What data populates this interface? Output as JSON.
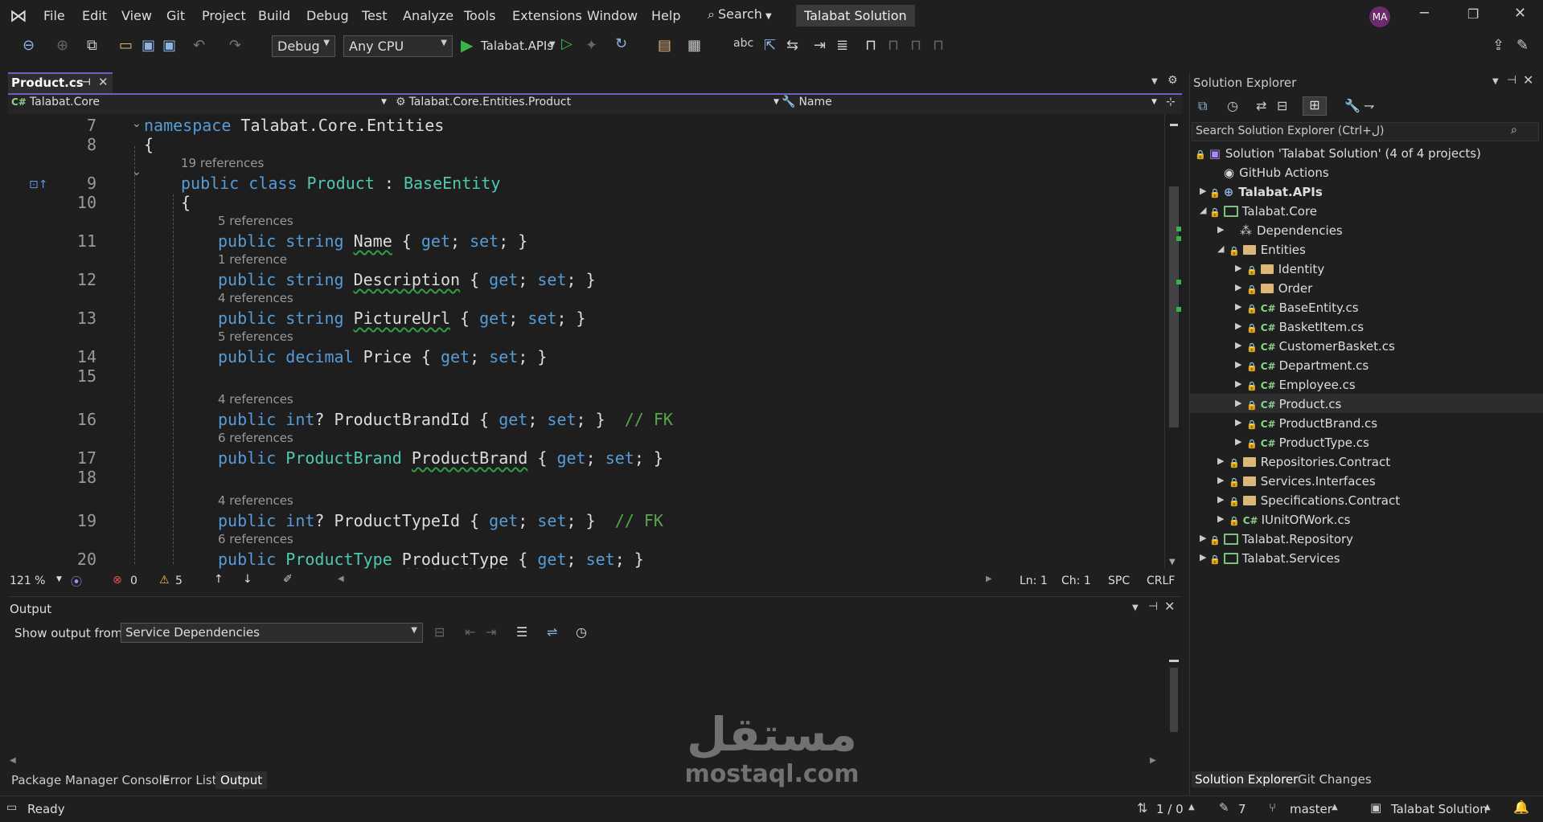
{
  "menu": {
    "items": [
      "File",
      "Edit",
      "View",
      "Git",
      "Project",
      "Build",
      "Debug",
      "Test",
      "Analyze",
      "Tools",
      "Extensions",
      "Window",
      "Help"
    ],
    "search": "Search",
    "solution_title": "Talabat Solution",
    "avatar": "MA"
  },
  "toolbar": {
    "config": "Debug",
    "platform": "Any CPU",
    "startup": "Talabat.APIs"
  },
  "tab": {
    "name": "Product.cs"
  },
  "nav": {
    "project": "Talabat.Core",
    "type": "Talabat.Core.Entities.Product",
    "member": "Name"
  },
  "code": {
    "l7": "7",
    "l8": "8",
    "l9": "9",
    "l10": "10",
    "l11": "11",
    "l12": "12",
    "l13": "13",
    "l14": "14",
    "l15": "15",
    "l16": "16",
    "l17": "17",
    "l18": "18",
    "l19": "19",
    "l20": "20",
    "r19": "19 references",
    "r5a": "5 references",
    "r1": "1 reference",
    "r4a": "4 references",
    "r5b": "5 references",
    "r4b": "4 references",
    "r6a": "6 references",
    "r4c": "4 references",
    "r6b": "6 references",
    "line7a": "namespace",
    "line7b": " Talabat.Core.Entities",
    "line8": "{",
    "line9a": "public class ",
    "line9b": "Product",
    "line9c": " : ",
    "line9d": "BaseEntity",
    "line10": "{",
    "line11a": "public string ",
    "line11b": "Name",
    "line11c": " { ",
    "get": "get",
    "semi": "; ",
    "set": "set",
    "close": "; }",
    "line12b": "Description",
    "line13b": "PictureUrl",
    "line14a": "public decimal ",
    "line14b": "Price",
    "line16a": "public int",
    "line16b": "? ProductBrandId { ",
    "fk": "// FK",
    "line17a": "public ",
    "line17b": "ProductBrand",
    "line17c": "ProductBrand",
    "line19b": "? ProductTypeId { ",
    "line20b": "ProductType",
    "line20c": "ProductType"
  },
  "editor_status": {
    "zoom": "121 %",
    "errors": "0",
    "warnings": "5",
    "ln": "Ln: 1",
    "ch": "Ch: 1",
    "spc": "SPC",
    "crlf": "CRLF"
  },
  "output": {
    "title": "Output",
    "show_label": "Show output from:",
    "source": "Service Dependencies"
  },
  "bottom_tabs": [
    "Package Manager Console",
    "Error List",
    "Output"
  ],
  "solution_explorer": {
    "title": "Solution Explorer",
    "search": "Search Solution Explorer (Ctrl+ل)",
    "solution": "Solution 'Talabat Solution' (4 of 4 projects)",
    "github": "GitHub Actions",
    "apis": "Talabat.APIs",
    "core": "Talabat.Core",
    "deps": "Dependencies",
    "entities": "Entities",
    "identity": "Identity",
    "order": "Order",
    "files": [
      "BaseEntity.cs",
      "BasketItem.cs",
      "CustomerBasket.cs",
      "Department.cs",
      "Employee.cs",
      "Product.cs",
      "ProductBrand.cs",
      "ProductType.cs"
    ],
    "repo_contract": "Repositories.Contract",
    "services_if": "Services.Interfaces",
    "spec_contract": "Specifications.Contract",
    "iuow": "IUnitOfWork.cs",
    "repository": "Talabat.Repository",
    "services": "Talabat.Services"
  },
  "se_tabs": [
    "Solution Explorer",
    "Git Changes"
  ],
  "statusbar": {
    "ready": "Ready",
    "lines": "1 / 0",
    "edits": "7",
    "branch": "master",
    "solution": "Talabat Solution"
  },
  "watermark": {
    "arabic": "مستقل",
    "latin": "mostaql.com"
  }
}
